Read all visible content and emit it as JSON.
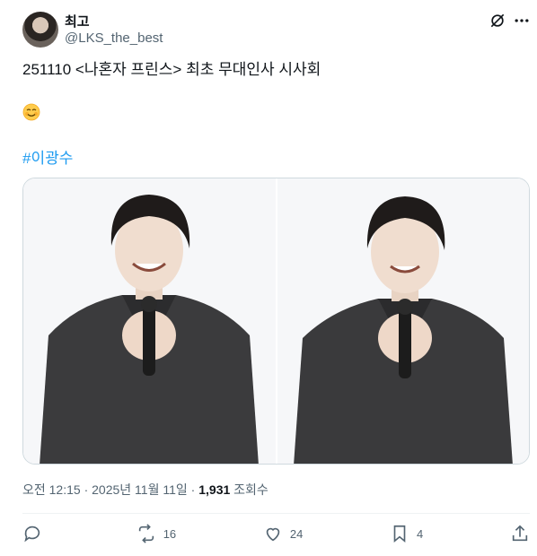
{
  "author": {
    "display_name": "최고",
    "handle": "@LKS_the_best"
  },
  "header_icons": [
    "grok-icon",
    "more-icon"
  ],
  "tweet": {
    "text": "251110 <나혼자 프린스> 최초 무대인사 시사회",
    "emoji": "smiling-face-with-smiling-eyes",
    "hashtag": "#이광수"
  },
  "media": {
    "count": 2,
    "description_icons": [
      "photo-left",
      "photo-right"
    ]
  },
  "meta": {
    "time": "오전 12:15",
    "separator": "·",
    "date": "2025년 11월 11일",
    "views_count": "1,931",
    "views_label": "조회수"
  },
  "actions": {
    "reply_count": "",
    "retweet_count": "16",
    "like_count": "24",
    "bookmark_count": "4"
  }
}
